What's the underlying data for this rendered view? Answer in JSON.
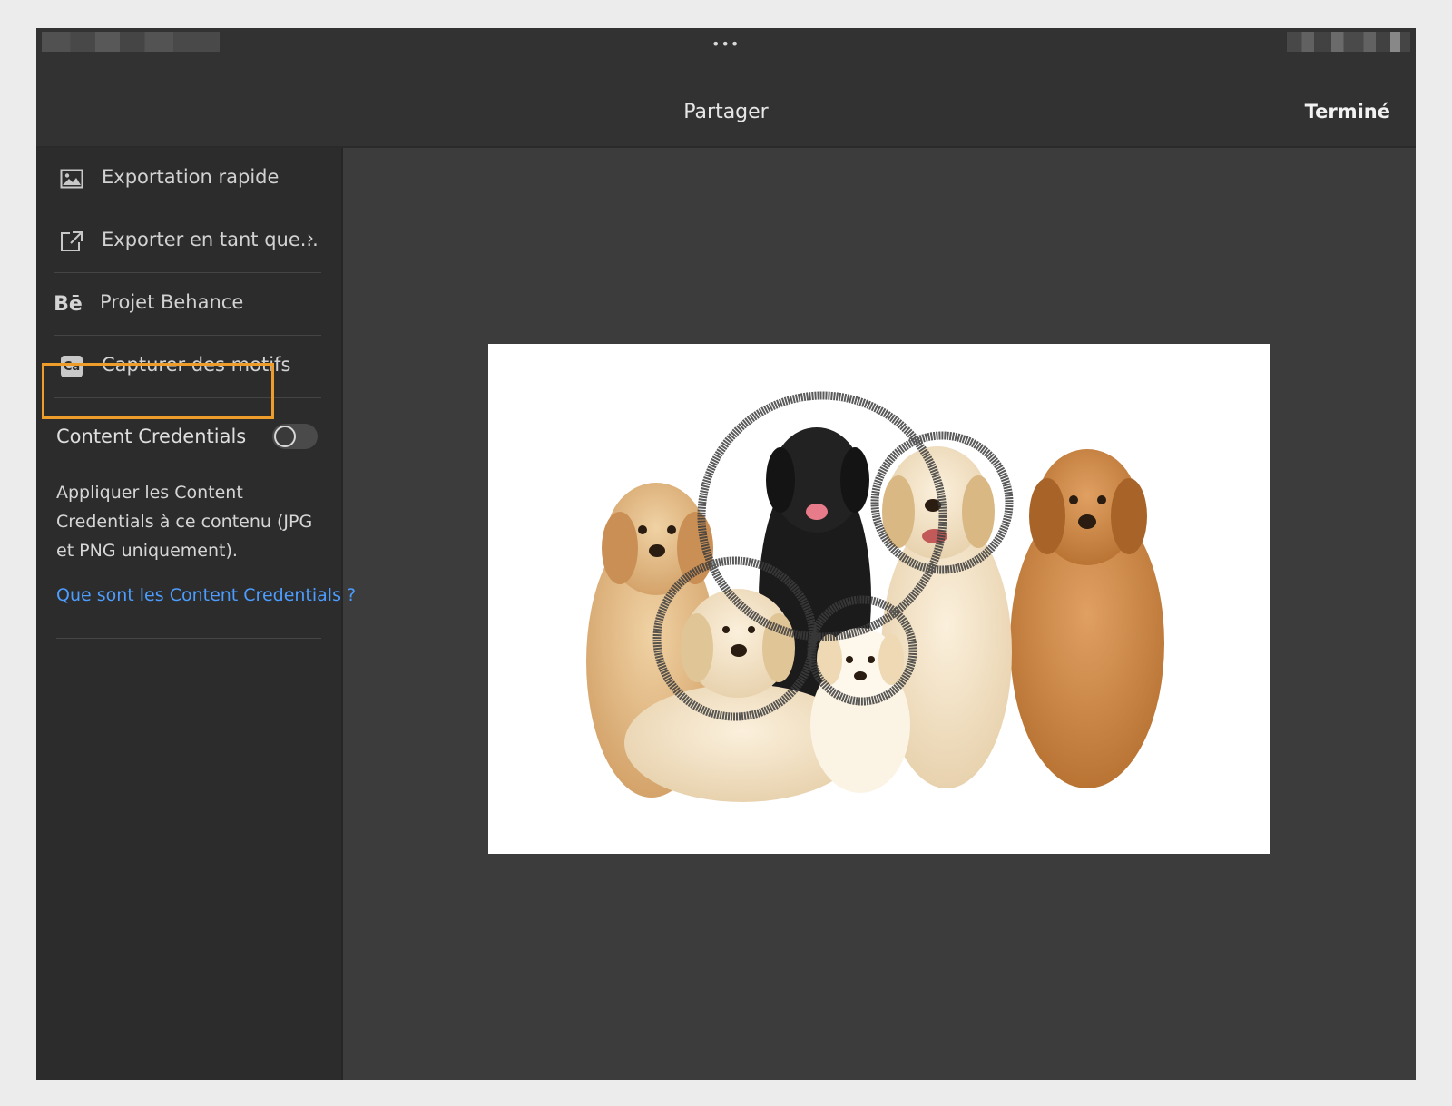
{
  "header": {
    "title": "Partager",
    "done_label": "Terminé",
    "more_glyph": "•••"
  },
  "menu": {
    "items": [
      {
        "label": "Exportation rapide",
        "icon": "image-icon"
      },
      {
        "label": "Exporter en tant que...",
        "icon": "export-icon",
        "chevron": "›"
      },
      {
        "label": "Projet Behance",
        "icon": "behance-icon",
        "icon_text": "Bē"
      },
      {
        "label": "Capturer des motifs",
        "icon": "capture-icon",
        "icon_text": "Ca"
      }
    ]
  },
  "content_credentials": {
    "label": "Content Credentials",
    "enabled": false,
    "description": "Appliquer les Content Credentials à ce contenu (JPG et PNG uniquement).",
    "link_label": "Que sont les Content Credentials ?"
  },
  "colors": {
    "highlight": "#ef9d2a",
    "link": "#4c9dff"
  }
}
